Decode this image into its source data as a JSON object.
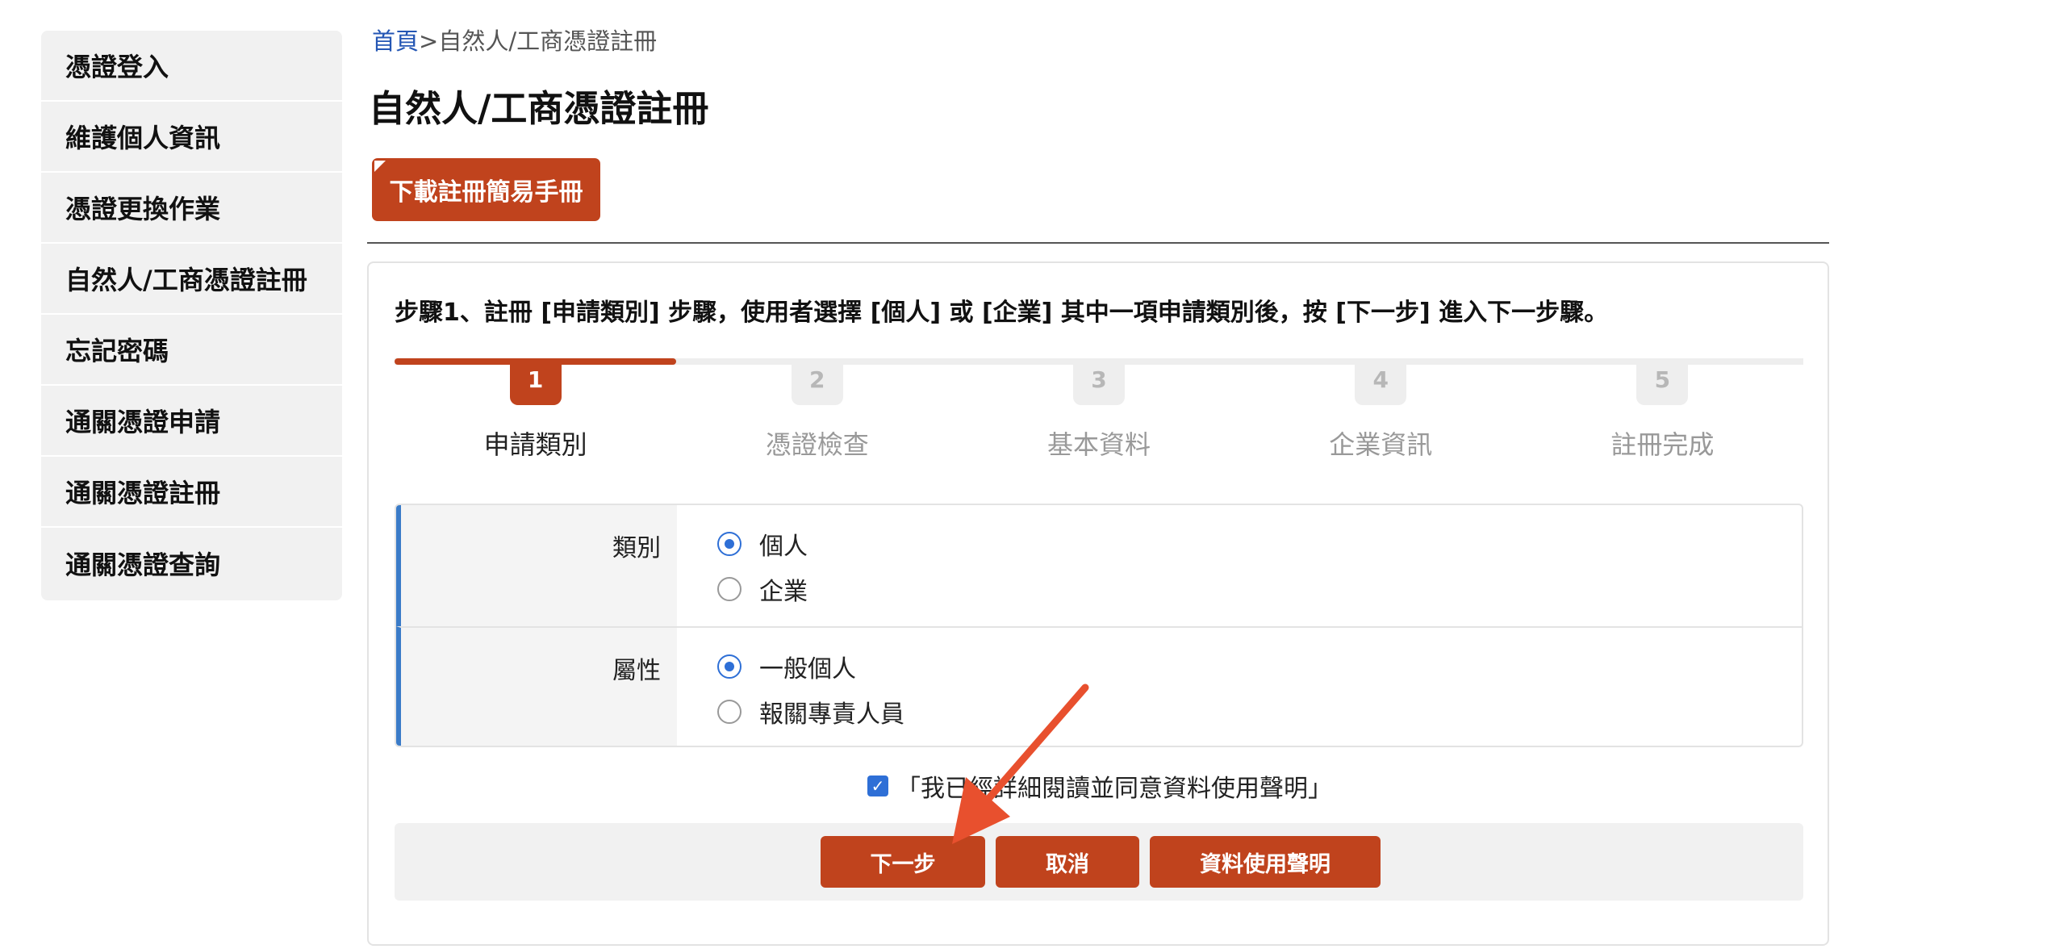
{
  "sidebar": {
    "items": [
      {
        "label": "憑證登入"
      },
      {
        "label": "維護個人資訊"
      },
      {
        "label": "憑證更換作業"
      },
      {
        "label": "自然人/工商憑證註冊"
      },
      {
        "label": "忘記密碼"
      },
      {
        "label": "通關憑證申請"
      },
      {
        "label": "通關憑證註冊"
      },
      {
        "label": "通關憑證查詢"
      }
    ]
  },
  "breadcrumb": {
    "home": "首頁",
    "separator": ">",
    "current": "自然人/工商憑證註冊"
  },
  "page": {
    "title": "自然人/工商憑證註冊",
    "download_label": "下載註冊簡易手冊"
  },
  "step_description": "步驟1、註冊 [申請類別] 步驟，使用者選擇 [個人] 或 [企業] 其中一項申請類別後，按 [下一步] 進入下一步驟。",
  "progress": {
    "current_step": 1,
    "total_steps": 5,
    "steps": [
      {
        "num": "1",
        "label": "申請類別"
      },
      {
        "num": "2",
        "label": "憑證檢查"
      },
      {
        "num": "3",
        "label": "基本資料"
      },
      {
        "num": "4",
        "label": "企業資訊"
      },
      {
        "num": "5",
        "label": "註冊完成"
      }
    ]
  },
  "form": {
    "category": {
      "label": "類別",
      "options": [
        "個人",
        "企業"
      ],
      "selected": "個人"
    },
    "attribute": {
      "label": "屬性",
      "options": [
        "一般個人",
        "報關專責人員"
      ],
      "selected": "一般個人"
    }
  },
  "agreement": {
    "text": "「我已經詳細閱讀並同意資料使用聲明」",
    "checked": true
  },
  "buttons": {
    "next": "下一步",
    "cancel": "取消",
    "policy": "資料使用聲明"
  },
  "colors": {
    "accent": "#c0431d",
    "link": "#2456b4",
    "radio": "#2e6fd6",
    "row_marker": "#3a7bc8",
    "annotation_arrow": "#e8502e"
  }
}
